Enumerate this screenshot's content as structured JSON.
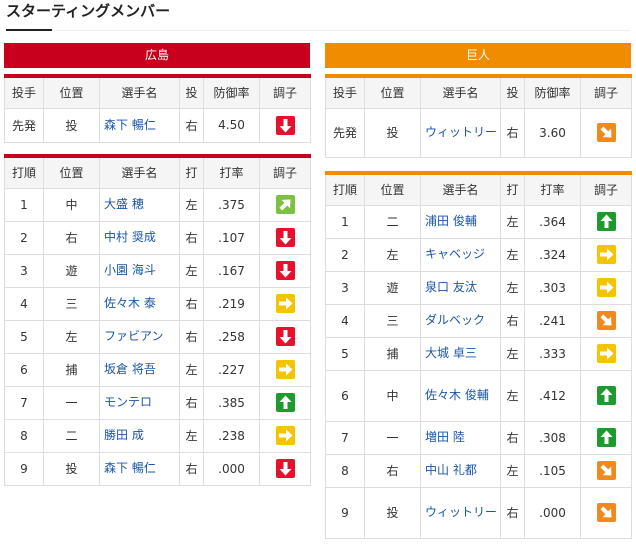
{
  "page_title": "スターティングメンバー",
  "columns": {
    "pitcher": [
      "投手",
      "位置",
      "選手名",
      "投",
      "防御率",
      "調子"
    ],
    "batter": [
      "打順",
      "位置",
      "選手名",
      "打",
      "打率",
      "調子"
    ]
  },
  "teams": [
    {
      "name": "広島",
      "color": "#c8001e",
      "pitcher": {
        "role": "先発",
        "pos": "投",
        "name": "森下 暢仁",
        "hand": "右",
        "stat": "4.50",
        "form": "down"
      },
      "batters": [
        {
          "order": "1",
          "pos": "中",
          "name": "大盛 穂",
          "hand": "左",
          "avg": ".375",
          "form": "up-right"
        },
        {
          "order": "2",
          "pos": "右",
          "name": "中村 奨成",
          "hand": "右",
          "avg": ".107",
          "form": "down"
        },
        {
          "order": "3",
          "pos": "遊",
          "name": "小園 海斗",
          "hand": "左",
          "avg": ".167",
          "form": "down"
        },
        {
          "order": "4",
          "pos": "三",
          "name": "佐々木 泰",
          "hand": "右",
          "avg": ".219",
          "form": "right"
        },
        {
          "order": "5",
          "pos": "左",
          "name": "ファビアン",
          "hand": "右",
          "avg": ".258",
          "form": "down"
        },
        {
          "order": "6",
          "pos": "捕",
          "name": "坂倉 将吾",
          "hand": "左",
          "avg": ".227",
          "form": "right"
        },
        {
          "order": "7",
          "pos": "一",
          "name": "モンテロ",
          "hand": "右",
          "avg": ".385",
          "form": "up"
        },
        {
          "order": "8",
          "pos": "二",
          "name": "勝田 成",
          "hand": "左",
          "avg": ".238",
          "form": "right"
        },
        {
          "order": "9",
          "pos": "投",
          "name": "森下 暢仁",
          "hand": "右",
          "avg": ".000",
          "form": "down"
        }
      ]
    },
    {
      "name": "巨人",
      "color": "#f08c00",
      "pitcher": {
        "role": "先発",
        "pos": "投",
        "name": "ウィットリー",
        "hand": "右",
        "stat": "3.60",
        "form": "down-right"
      },
      "batters": [
        {
          "order": "1",
          "pos": "二",
          "name": "浦田 俊輔",
          "hand": "左",
          "avg": ".364",
          "form": "up"
        },
        {
          "order": "2",
          "pos": "左",
          "name": "キャベッジ",
          "hand": "左",
          "avg": ".324",
          "form": "right"
        },
        {
          "order": "3",
          "pos": "遊",
          "name": "泉口 友汰",
          "hand": "左",
          "avg": ".303",
          "form": "right"
        },
        {
          "order": "4",
          "pos": "三",
          "name": "ダルベック",
          "hand": "右",
          "avg": ".241",
          "form": "down-right"
        },
        {
          "order": "5",
          "pos": "捕",
          "name": "大城 卓三",
          "hand": "左",
          "avg": ".333",
          "form": "right"
        },
        {
          "order": "6",
          "pos": "中",
          "name": "佐々木 俊輔",
          "hand": "左",
          "avg": ".412",
          "form": "up"
        },
        {
          "order": "7",
          "pos": "一",
          "name": "増田 陸",
          "hand": "右",
          "avg": ".308",
          "form": "up"
        },
        {
          "order": "8",
          "pos": "右",
          "name": "中山 礼都",
          "hand": "左",
          "avg": ".105",
          "form": "down-right"
        },
        {
          "order": "9",
          "pos": "投",
          "name": "ウィットリー",
          "hand": "右",
          "avg": ".000",
          "form": "down-right"
        }
      ]
    }
  ]
}
